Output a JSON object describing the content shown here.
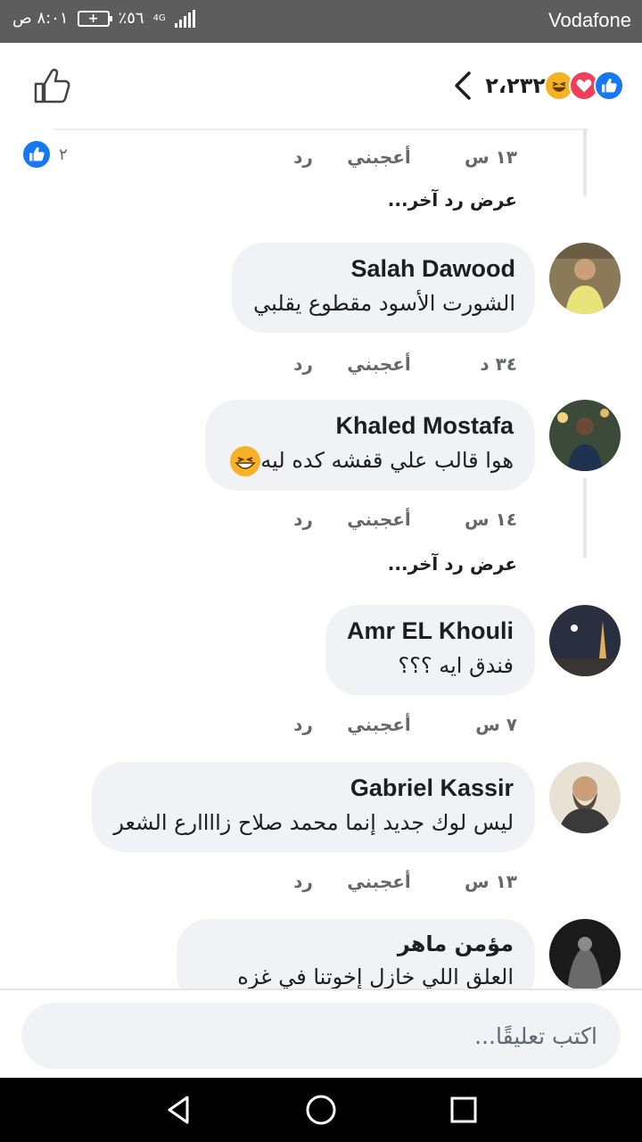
{
  "status_bar": {
    "carrier": "Vodafone",
    "time": "٨:٠١ ص",
    "battery": "٪٥٦",
    "network": "4G"
  },
  "header": {
    "reaction_count": "٢،٢٣٢",
    "reactions": [
      "like",
      "love",
      "haha"
    ]
  },
  "top_reply": {
    "time": "١٣ س",
    "like_label": "أعجبني",
    "reply_label": "رد",
    "reaction_count": "٢",
    "view_more": "عرض رد آخر..."
  },
  "comments": [
    {
      "name": "Salah Dawood",
      "text": "الشورت الأسود مقطوع يقلبي",
      "time": "٣٤ د",
      "like_label": "أعجبني",
      "reply_label": "رد"
    },
    {
      "name": "Khaled Mostafa",
      "text": "هوا قالب علي قفشه كده ليه",
      "time": "١٤ س",
      "like_label": "أعجبني",
      "reply_label": "رد",
      "view_more": "عرض رد آخر..."
    },
    {
      "name": "Amr EL Khouli",
      "text": "فندق ايه ؟؟؟",
      "time": "٧ س",
      "like_label": "أعجبني",
      "reply_label": "رد"
    },
    {
      "name": "Gabriel Kassir",
      "text": "ليس لوك جديد إنما محمد صلاح زاااارع الشعر",
      "time": "١٣ س",
      "like_label": "أعجبني",
      "reply_label": "رد"
    },
    {
      "name": "مؤمن ماهر",
      "text": "العلق اللي خازل إخوتنا في غزه"
    }
  ],
  "composer": {
    "placeholder": "اكتب تعليقًا..."
  },
  "colors": {
    "facebook_blue": "#1877f2",
    "love_red": "#f33e58",
    "haha_yellow": "#f7b125",
    "bubble_gray": "#f0f2f5"
  }
}
